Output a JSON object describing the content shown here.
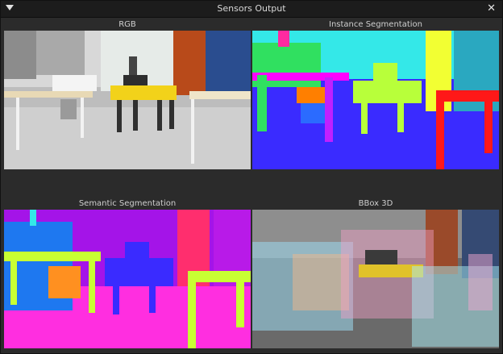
{
  "window": {
    "title": "Sensors Output"
  },
  "panels": [
    {
      "label": "RGB"
    },
    {
      "label": "Instance Segmentation"
    },
    {
      "label": "Semantic Segmentation"
    },
    {
      "label": "BBox 3D"
    }
  ]
}
